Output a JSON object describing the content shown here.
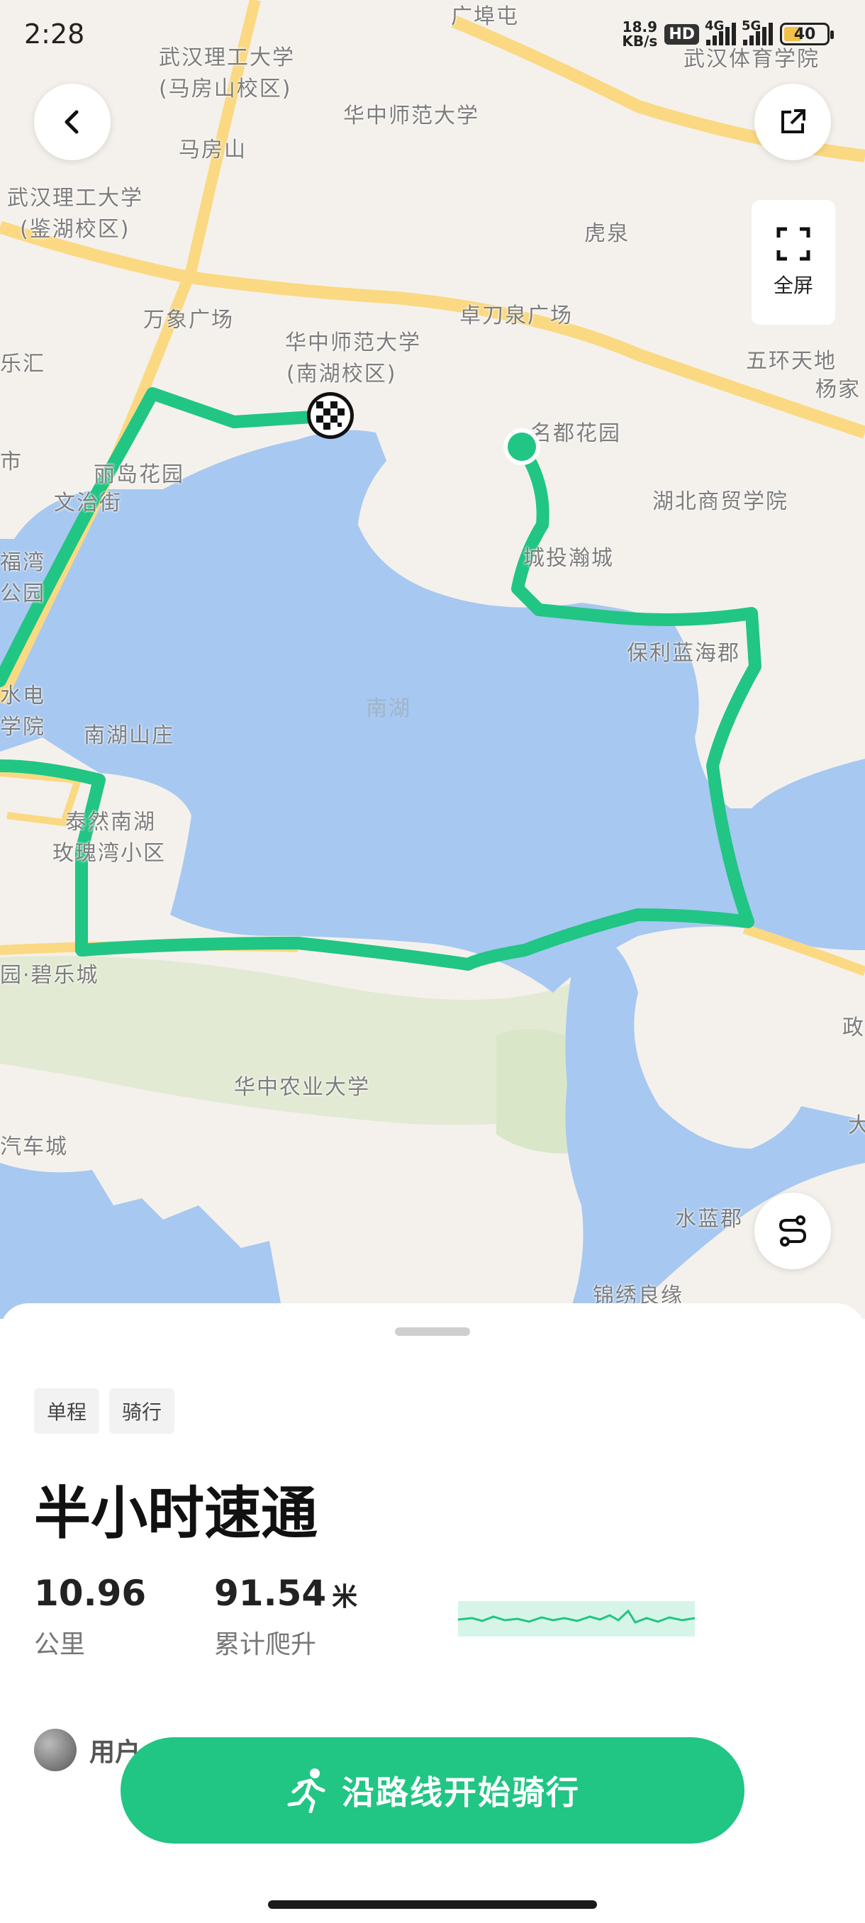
{
  "status_bar": {
    "time": "2:28",
    "net_speed_value": "18.9",
    "net_speed_unit": "KB/s",
    "hd_badge": "HD",
    "sig1_label": "4G",
    "sig2_label": "5G",
    "battery": "40"
  },
  "map": {
    "fullscreen_label": "全屏",
    "lake_label": "南湖",
    "labels": [
      "广埠屯",
      "武汉体育学院",
      "武汉理工大学",
      "(马房山校区)",
      "华中师范大学",
      "马房山",
      "武汉理工大学",
      "(鉴湖校区)",
      "虎泉",
      "万象广场",
      "华中师范大学",
      "(南湖校区)",
      "卓刀泉广场",
      "五环天地",
      "杨家",
      "乐汇",
      "名都花园",
      "市",
      "丽岛花园",
      "文治街",
      "湖北商贸学院",
      "城投瀚城",
      "福湾",
      "公园",
      "保利蓝海郡",
      "水电",
      "学院",
      "南湖山庄",
      "泰然南湖",
      "玫瑰湾小区",
      "园·碧乐城",
      "政",
      "华中农业大学",
      "汽车城",
      "大",
      "水蓝郡",
      "锦绣良缘"
    ]
  },
  "route": {
    "tags": [
      "单程",
      "骑行"
    ],
    "title": "半小时速通",
    "distance_value": "10.96",
    "distance_label": "公里",
    "climb_value": "91.54",
    "climb_unit": "米",
    "climb_label": "累计爬升",
    "author_name": "用户"
  },
  "cta": {
    "label": "沿路线开始骑行"
  },
  "colors": {
    "accent": "#21c584",
    "water": "#a7c8f0",
    "road": "#fbd982"
  }
}
